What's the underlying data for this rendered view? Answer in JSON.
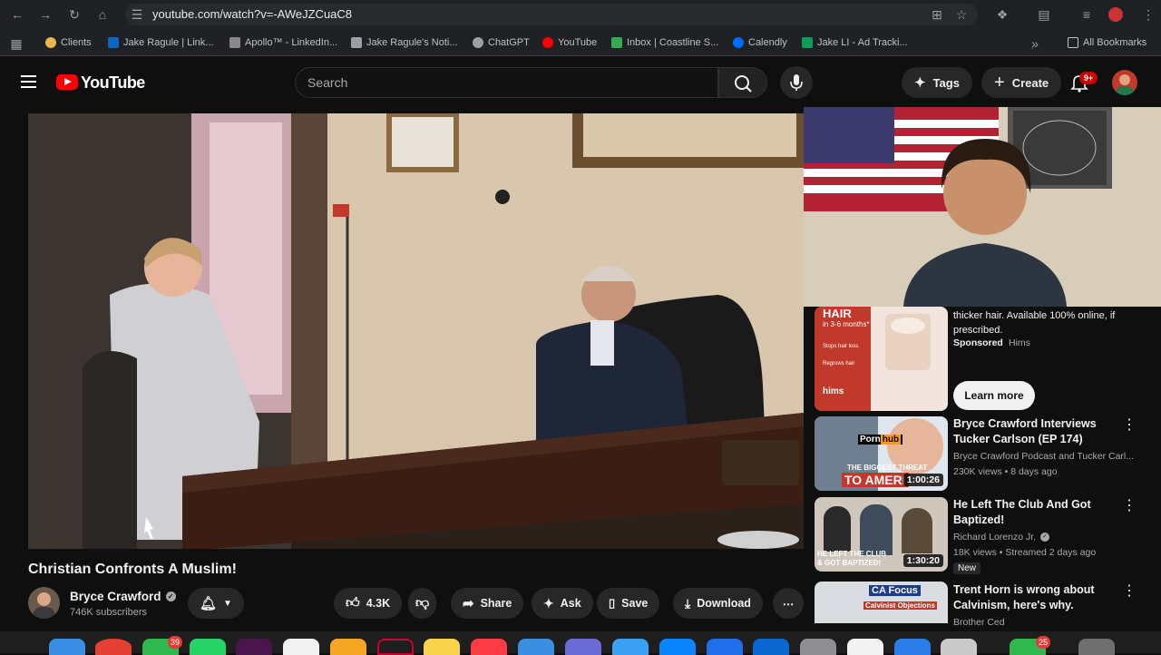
{
  "browser": {
    "url": "youtube.com/watch?v=-AWeJZCuaC8",
    "bookmarks": [
      {
        "label": "Clients",
        "color": "#e8b64a"
      },
      {
        "label": "Jake Ragule | Link...",
        "color": "#0a66c2"
      },
      {
        "label": "Apollo™ - LinkedIn...",
        "color": "#888888"
      },
      {
        "label": "Jake Ragule's Noti...",
        "color": "#9aa0a6"
      },
      {
        "label": "ChatGPT",
        "color": "#9aa0a6"
      },
      {
        "label": "YouTube",
        "color": "#ff0000"
      },
      {
        "label": "Inbox | Coastline S...",
        "color": "#34a853"
      },
      {
        "label": "Calendly",
        "color": "#006bff"
      },
      {
        "label": "Jake LI - Ad Tracki...",
        "color": "#0f9d58"
      }
    ],
    "all_bookmarks": "All Bookmarks"
  },
  "header": {
    "logo_text": "YouTube",
    "search_placeholder": "Search",
    "tags_label": "Tags",
    "create_label": "Create",
    "notif_badge": "9+"
  },
  "video": {
    "title": "Christian Confronts A Muslim!",
    "channel": "Bryce Crawford",
    "subscribers": "746K subscribers",
    "likes": "4.3K",
    "share_label": "Share",
    "ask_label": "Ask",
    "save_label": "Save",
    "download_label": "Download"
  },
  "ad": {
    "thumb_heading": "HAIR",
    "thumb_sub": "in 3-6 months*",
    "thumb_lines": [
      "Stops hair loss",
      "Regrows hair"
    ],
    "thumb_brand": "hims",
    "desc": "thicker hair. Available 100% online, if prescribed.",
    "sponsored": "Sponsored",
    "advertiser": "Hims",
    "cta": "Learn more"
  },
  "sidebar": [
    {
      "title": "Bryce Crawford Interviews Tucker Carlson (EP 174)",
      "channel": "Bryce Crawford Podcast and Tucker Carl...",
      "meta": "230K views • 8 days ago",
      "duration": "1:00:26",
      "thumb_text": [
        "Porn",
        "hub",
        "THE BIGGEST THREAT",
        "TO AMERI"
      ]
    },
    {
      "title": "He Left The Club And Got Baptized!",
      "channel": "Richard Lorenzo Jr.",
      "meta": "18K views • Streamed 2 days ago",
      "badge": "New",
      "duration": "1:30:20",
      "thumb_text": [
        "HE LEFT THE CLUB",
        "& GOT BAPTIZED!"
      ]
    },
    {
      "title": "Trent Horn is wrong about Calvinism, here's why.",
      "channel": "Brother Ced",
      "thumb_text": [
        "CA Focus",
        "Calvinist Objections"
      ]
    }
  ],
  "dock": {
    "badges": [
      "39",
      "25"
    ]
  }
}
